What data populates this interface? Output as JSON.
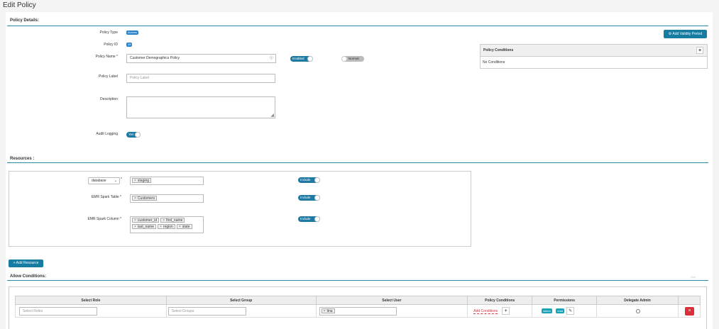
{
  "page_title": "Edit Policy",
  "policy_details": {
    "section_title": "Policy Details:",
    "policy_type_label": "Policy Type",
    "policy_type_value": "Access",
    "policy_id_label": "Policy ID",
    "policy_id_value": "28",
    "policy_name_label": "Policy Name *",
    "policy_name_value": "Customer Demographics Policy",
    "enabled_toggle": "Enabled",
    "normal_toggle": "Normal",
    "policy_label_label": "Policy Label",
    "policy_label_placeholder": "Policy Label",
    "description_label": "Description",
    "audit_logging_label": "Audit Logging",
    "audit_logging_value": "Yes"
  },
  "validity": {
    "button_label": "Add Validity Period",
    "conditions_title": "Policy Conditions",
    "conditions_add": "+",
    "conditions_empty": "No Conditions"
  },
  "resources": {
    "section_title": "Resources :",
    "database_select": "database",
    "database_required": "*",
    "database_tags": [
      "staging"
    ],
    "table_label": "EMR Spark Table *",
    "table_tags": [
      "Customers"
    ],
    "column_label": "EMR Spark Column *",
    "column_tags": [
      "customer_id",
      "first_name",
      "last_name",
      "region",
      "state"
    ],
    "include_label": "Include",
    "add_resource_button": "Add Resource"
  },
  "allow_conditions": {
    "section_title": "Allow Conditions:",
    "hide_label": "hide",
    "columns": [
      "Select Role",
      "Select Group",
      "Select User",
      "Policy Conditions",
      "Permissions",
      "Delegate Admin"
    ],
    "row": {
      "roles_placeholder": "Select Roles",
      "groups_placeholder": "Select Groups",
      "user_tag": "tina",
      "add_conditions": "Add Conditions",
      "add_conditions_plus": "+",
      "permissions": [
        "select",
        "read"
      ]
    }
  },
  "colors": {
    "accent": "#177ca1",
    "danger": "#d9303a",
    "line": "#2a8aa8"
  }
}
